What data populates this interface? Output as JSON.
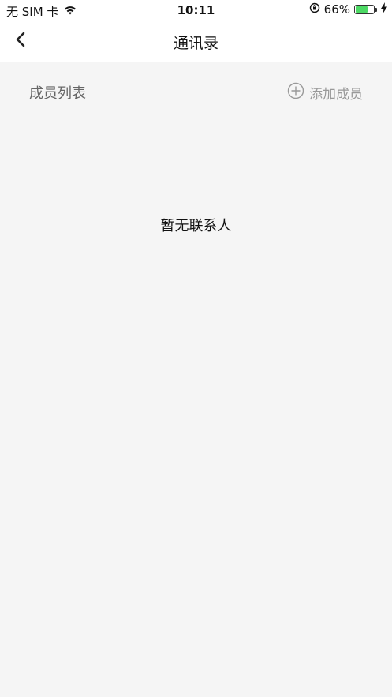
{
  "status_bar": {
    "carrier": "无 SIM 卡",
    "time": "10:11",
    "battery_percent": "66%",
    "battery_level": 0.66,
    "battery_color": "#4cd964"
  },
  "nav": {
    "title": "通讯录",
    "back_icon": "chevron-left-icon"
  },
  "section": {
    "title": "成员列表",
    "add_label": "添加成员",
    "add_icon": "plus-circle-icon"
  },
  "empty_state": {
    "message": "暂无联系人"
  }
}
